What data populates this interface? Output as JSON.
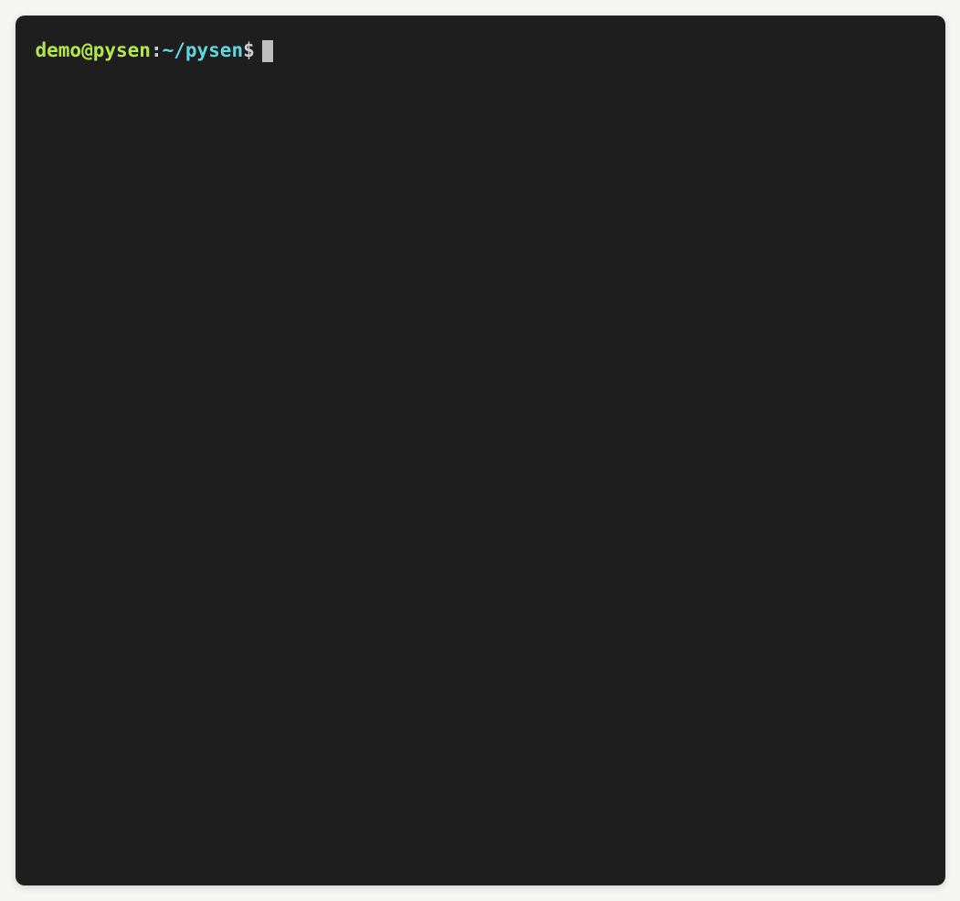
{
  "prompt": {
    "user_host": "demo@pysen",
    "separator": ":",
    "cwd": "~/pysen",
    "symbol": "$",
    "command": ""
  },
  "colors": {
    "background": "#1e1e1e",
    "user_host": "#b3e84a",
    "cwd": "#5ed7e0",
    "text": "#d0d0d0",
    "cursor": "#bfbfbf"
  }
}
